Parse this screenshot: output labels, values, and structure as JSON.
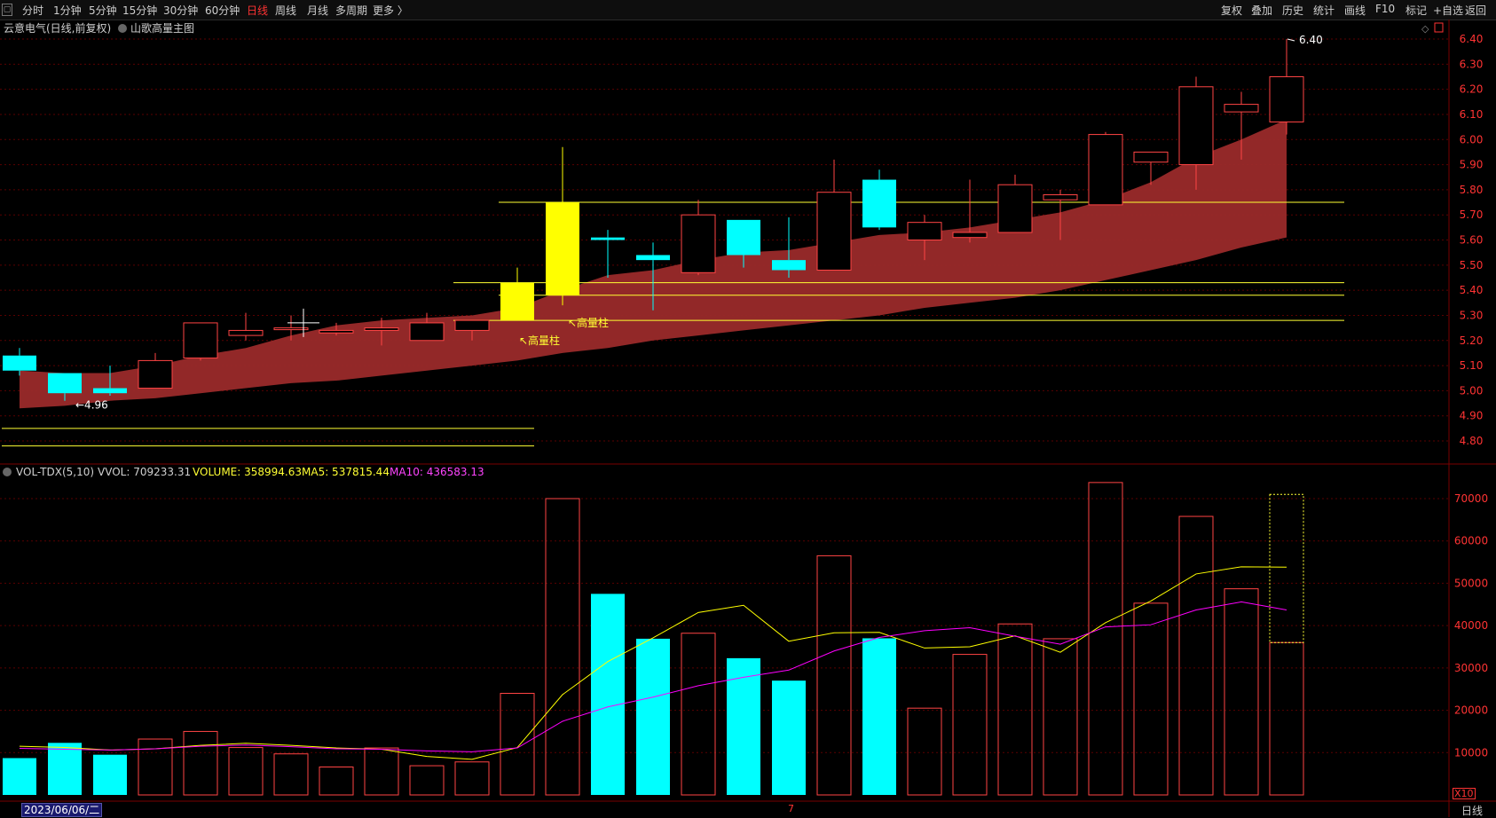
{
  "toolbar": {
    "menu_icon": "menu-icon",
    "periods": [
      "分时",
      "1分钟",
      "5分钟",
      "15分钟",
      "30分钟",
      "60分钟",
      "日线",
      "周线",
      "月线",
      "多周期",
      "更多 〉"
    ],
    "active_period": "日线",
    "right_buttons": [
      "复权",
      "叠加",
      "历史",
      "统计",
      "画线",
      "F10",
      "标记",
      "+自选",
      "返回"
    ]
  },
  "main": {
    "title": "云意电气(日线,前复权)",
    "indicator_name": "山歌高量主图",
    "high_label": "6.40",
    "low_label": "4.96",
    "high_volume_labels": [
      "高量柱",
      "高量柱"
    ],
    "y_ticks": [
      "6.40",
      "6.30",
      "6.20",
      "6.10",
      "6.00",
      "5.90",
      "5.80",
      "5.70",
      "5.60",
      "5.50",
      "5.40",
      "5.30",
      "5.20",
      "5.10",
      "5.00",
      "4.90",
      "4.80"
    ]
  },
  "volume": {
    "indicator": "VOL-TDX(5,10)",
    "vvol": "VVOL: 709233.31",
    "volume": "VOLUME: 358994.63",
    "ma5": "MA5: 537815.44",
    "ma10": "MA10: 436583.13",
    "y_ticks": [
      "70000",
      "60000",
      "50000",
      "40000",
      "30000",
      "20000",
      "10000"
    ],
    "unit_label": "X10"
  },
  "footer": {
    "date": "2023/06/06/二",
    "marker": "7",
    "period_button": "日线"
  },
  "colors": {
    "up": "#ff4444",
    "down": "#00ffff",
    "high_volume": "#ffff00",
    "band": "#9a2a2a",
    "ma5": "#ffff00",
    "ma10": "#ff00ff",
    "grid": "#5a0000"
  },
  "chart_data": [
    {
      "type": "candlestick",
      "title": "云意电气(日线,前复权)",
      "ylim": [
        4.75,
        6.45
      ],
      "candles": [
        {
          "o": 5.14,
          "h": 5.17,
          "l": 5.06,
          "c": 5.08
        },
        {
          "o": 5.07,
          "h": 5.07,
          "l": 4.96,
          "c": 4.99
        },
        {
          "o": 5.01,
          "h": 5.1,
          "l": 4.98,
          "c": 4.99
        },
        {
          "o": 5.01,
          "h": 5.15,
          "l": 5.01,
          "c": 5.12
        },
        {
          "o": 5.13,
          "h": 5.26,
          "l": 5.12,
          "c": 5.27
        },
        {
          "o": 5.22,
          "h": 5.31,
          "l": 5.2,
          "c": 5.24
        },
        {
          "o": 5.25,
          "h": 5.3,
          "l": 5.2,
          "c": 5.25
        },
        {
          "o": 5.23,
          "h": 5.27,
          "l": 5.22,
          "c": 5.24
        },
        {
          "o": 5.24,
          "h": 5.29,
          "l": 5.18,
          "c": 5.25
        },
        {
          "o": 5.2,
          "h": 5.31,
          "l": 5.2,
          "c": 5.27
        },
        {
          "o": 5.24,
          "h": 5.28,
          "l": 5.2,
          "c": 5.28
        },
        {
          "o": 5.28,
          "h": 5.49,
          "l": 5.28,
          "c": 5.43
        },
        {
          "o": 5.38,
          "h": 5.97,
          "l": 5.34,
          "c": 5.75
        },
        {
          "o": 5.61,
          "h": 5.64,
          "l": 5.45,
          "c": 5.6
        },
        {
          "o": 5.54,
          "h": 5.59,
          "l": 5.32,
          "c": 5.52
        },
        {
          "o": 5.47,
          "h": 5.76,
          "l": 5.46,
          "c": 5.7
        },
        {
          "o": 5.68,
          "h": 5.68,
          "l": 5.49,
          "c": 5.54
        },
        {
          "o": 5.52,
          "h": 5.69,
          "l": 5.45,
          "c": 5.48
        },
        {
          "o": 5.48,
          "h": 5.92,
          "l": 5.48,
          "c": 5.79
        },
        {
          "o": 5.84,
          "h": 5.88,
          "l": 5.64,
          "c": 5.65
        },
        {
          "o": 5.6,
          "h": 5.7,
          "l": 5.52,
          "c": 5.67
        },
        {
          "o": 5.61,
          "h": 5.84,
          "l": 5.59,
          "c": 5.63
        },
        {
          "o": 5.63,
          "h": 5.86,
          "l": 5.63,
          "c": 5.82
        },
        {
          "o": 5.76,
          "h": 5.8,
          "l": 5.6,
          "c": 5.78
        },
        {
          "o": 5.74,
          "h": 6.03,
          "l": 5.74,
          "c": 6.02
        },
        {
          "o": 5.91,
          "h": 5.95,
          "l": 5.82,
          "c": 5.95
        },
        {
          "o": 5.9,
          "h": 6.25,
          "l": 5.8,
          "c": 6.21
        },
        {
          "o": 6.11,
          "h": 6.19,
          "l": 5.92,
          "c": 6.14
        },
        {
          "o": 6.07,
          "h": 6.4,
          "l": 6.02,
          "c": 6.25
        }
      ],
      "band_upper": [
        5.08,
        5.07,
        5.07,
        5.1,
        5.14,
        5.17,
        5.22,
        5.26,
        5.28,
        5.29,
        5.3,
        5.33,
        5.4,
        5.46,
        5.48,
        5.52,
        5.55,
        5.56,
        5.59,
        5.62,
        5.63,
        5.65,
        5.68,
        5.71,
        5.76,
        5.83,
        5.93,
        6.0,
        6.08
      ],
      "band_lower": [
        4.93,
        4.94,
        4.96,
        4.97,
        4.99,
        5.01,
        5.03,
        5.04,
        5.06,
        5.08,
        5.1,
        5.12,
        5.15,
        5.17,
        5.2,
        5.22,
        5.24,
        5.26,
        5.28,
        5.3,
        5.33,
        5.35,
        5.37,
        5.4,
        5.44,
        5.48,
        5.52,
        5.57,
        5.61
      ],
      "high_volume_bars": [
        11,
        12
      ],
      "horizontal_lines": [
        {
          "y": 5.75,
          "from_bar": 11,
          "to_bar": 30
        },
        {
          "y": 5.43,
          "from_bar": 10,
          "to_bar": 30
        },
        {
          "y": 5.38,
          "from_bar": 11,
          "to_bar": 30
        },
        {
          "y": 5.28,
          "from_bar": 10,
          "to_bar": 30
        },
        {
          "y": 4.85,
          "from_bar": -1,
          "to_bar": 11
        },
        {
          "y": 4.78,
          "from_bar": -1,
          "to_bar": 11
        }
      ]
    },
    {
      "type": "bar",
      "title": "VOL-TDX(5,10)",
      "ylim": [
        0,
        75000
      ],
      "values": [
        8700,
        12300,
        9500,
        13200,
        15000,
        11200,
        9700,
        6600,
        11100,
        6900,
        7800,
        24000,
        70000,
        47500,
        36900,
        38200,
        32300,
        27000,
        56500,
        37000,
        20500,
        33200,
        40400,
        36900,
        73800,
        45300,
        65800,
        48700,
        36000
      ],
      "up": [
        false,
        false,
        false,
        true,
        true,
        true,
        true,
        true,
        true,
        true,
        true,
        true,
        true,
        false,
        false,
        true,
        false,
        false,
        true,
        false,
        true,
        true,
        true,
        true,
        true,
        true,
        true,
        true,
        true
      ],
      "last_bar_dotted_top": 71000,
      "series": [
        {
          "name": "MA5",
          "values": [
            11500,
            11200,
            10600,
            10900,
            11700,
            12200,
            11700,
            11100,
            10800,
            9100,
            8400,
            11200,
            23700,
            31500,
            37100,
            43100,
            44800,
            36300,
            38300,
            38400,
            34700,
            35000,
            37600,
            33700,
            40700,
            45800,
            52200,
            53900,
            53800
          ]
        },
        {
          "name": "MA10",
          "values": [
            11000,
            10800,
            10600,
            10900,
            11500,
            11800,
            11400,
            10900,
            10800,
            10400,
            10200,
            11100,
            17400,
            20800,
            23100,
            25800,
            27800,
            29500,
            34000,
            37200,
            38800,
            39500,
            37500,
            35600,
            39700,
            40200,
            43700,
            45600,
            43700
          ]
        }
      ]
    }
  ]
}
